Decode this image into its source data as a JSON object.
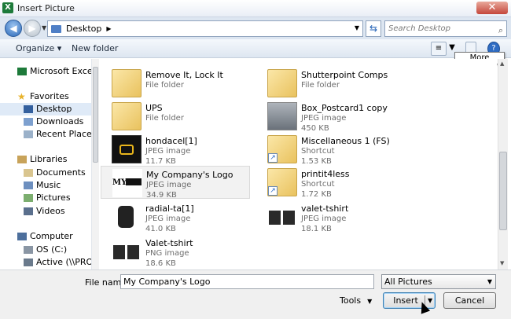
{
  "window": {
    "title": "Insert Picture",
    "app_icon": "X",
    "close_glyph": "✕"
  },
  "nav": {
    "back_glyph": "◀",
    "forward_glyph": "▶",
    "address": "Desktop",
    "address_arrow": "▶",
    "refresh_glyph": "⇆",
    "search_placeholder": "Search Desktop",
    "search_glyph": "⌕"
  },
  "toolbar": {
    "organize": "Organize ▾",
    "new_folder": "New folder",
    "more_options_tooltip": "More options",
    "help": "?"
  },
  "sidebar": {
    "items": [
      {
        "label": "Microsoft Excel",
        "icon": "excel-icon"
      },
      {
        "label": "Favorites",
        "icon": "star-icon"
      },
      {
        "label": "Desktop",
        "icon": "desktop-icon"
      },
      {
        "label": "Downloads",
        "icon": "downloads-icon"
      },
      {
        "label": "Recent Places",
        "icon": "recent-places-icon"
      },
      {
        "label": "Libraries",
        "icon": "libraries-icon"
      },
      {
        "label": "Documents",
        "icon": "documents-icon"
      },
      {
        "label": "Music",
        "icon": "music-icon"
      },
      {
        "label": "Pictures",
        "icon": "pictures-icon"
      },
      {
        "label": "Videos",
        "icon": "videos-icon"
      },
      {
        "label": "Computer",
        "icon": "computer-icon"
      },
      {
        "label": "OS (C:)",
        "icon": "drive-icon"
      },
      {
        "label": "Active (\\\\PROGR",
        "icon": "network-drive-icon"
      }
    ]
  },
  "files": [
    {
      "name": "Remove It, Lock It",
      "type": "File folder",
      "size": ""
    },
    {
      "name": "Shutterpoint Comps",
      "type": "File folder",
      "size": ""
    },
    {
      "name": "UPS",
      "type": "File folder",
      "size": ""
    },
    {
      "name": "Box_Postcard1 copy",
      "type": "JPEG image",
      "size": "450 KB"
    },
    {
      "name": "hondacel[1]",
      "type": "JPEG image",
      "size": "11.7 KB"
    },
    {
      "name": "Miscellaneous 1 (FS)",
      "type": "Shortcut",
      "size": "1.53 KB"
    },
    {
      "name": "My Company's Logo",
      "type": "JPEG image",
      "size": "34.9 KB",
      "thumb_text": "MY"
    },
    {
      "name": "printit4less",
      "type": "Shortcut",
      "size": "1.72 KB"
    },
    {
      "name": "radial-ta[1]",
      "type": "JPEG image",
      "size": "41.0 KB"
    },
    {
      "name": "valet-tshirt",
      "type": "JPEG image",
      "size": "18.1 KB"
    },
    {
      "name": "Valet-tshirt",
      "type": "PNG image",
      "size": "18.6 KB"
    }
  ],
  "bottom": {
    "file_name_label": "File name:",
    "file_name_value": "My Company's Logo",
    "file_type": "All Pictures",
    "tools": "Tools",
    "insert": "Insert",
    "cancel": "Cancel",
    "dropdown_glyph": "▼"
  },
  "colors": {
    "accent": "#3c7fb1",
    "selection": "#dfeaf7",
    "folder": "#e9c25e"
  }
}
